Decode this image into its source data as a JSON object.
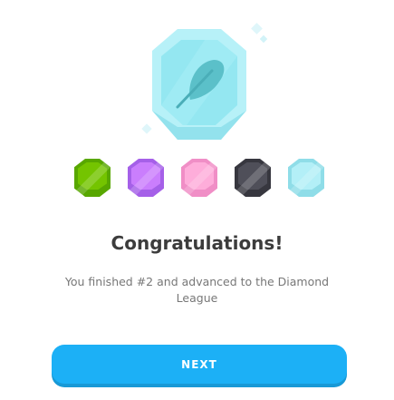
{
  "league_badge": {
    "icon": "feather-icon",
    "league": "Diamond",
    "color": "#a5ecf5"
  },
  "league_badges": [
    {
      "name": "Emerald",
      "color": "#78c800",
      "inner": "#6bb300"
    },
    {
      "name": "Amethyst",
      "color": "#ce82ff",
      "inner": "#c06bfb"
    },
    {
      "name": "Pearl",
      "color": "#ffb0dc",
      "inner": "#fca3d3"
    },
    {
      "name": "Obsidian",
      "color": "#4b4b55",
      "inner": "#3f3f48"
    },
    {
      "name": "Diamond",
      "color": "#a5ecf5",
      "inner": "#93e4ef"
    }
  ],
  "title": "Congratulations!",
  "message": "You finished #2 and advanced to the Diamond League",
  "next_label": "NEXT",
  "colors": {
    "button": "#1cb0f6",
    "button_shadow": "#1899d6"
  }
}
